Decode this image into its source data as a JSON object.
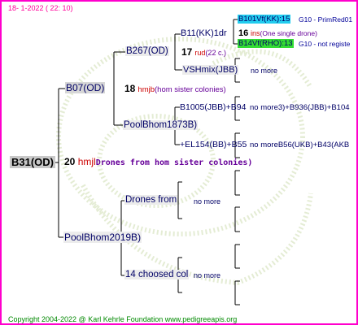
{
  "header": {
    "date": "18-  1-2022 ( 22: 10)"
  },
  "footer": {
    "copyright": "Copyright 2004-2022 @ Karl Kehrle Foundation   www.pedigreeapis.org"
  },
  "root": {
    "label": "B31(OD)",
    "num": "20",
    "code": "hmjl",
    "note": "Drones from hom sister colonies)"
  },
  "gen1": {
    "top": {
      "label": "B07(OD)",
      "num": "18",
      "code": "hmjb",
      "note": "(hom sister colonies)"
    },
    "bottom": {
      "label": "PoolBhom2019B)"
    }
  },
  "gen2": {
    "b267": {
      "label": "B267(OD)",
      "num": "17",
      "code": "rud",
      "note": "(22 c.)"
    },
    "poolbhom": {
      "label": "PoolBhom1873B)"
    },
    "drones": {
      "label": "Drones from",
      "no_more": "no more"
    },
    "chosen": {
      "label": "14 choosed col",
      "no_more": "no more"
    }
  },
  "gen3": {
    "b11": {
      "label": "B11(KK)1dr",
      "num": "16",
      "code": "ins",
      "note": "(One single drone)"
    },
    "vshmix": {
      "label": "VSHmix(JBB)",
      "no_more": "no more"
    },
    "b1005": {
      "label": "B1005(JBB)+B94",
      "extra": "no more3)+B936(JBB)+B104"
    },
    "el154": {
      "label": "+EL154(BB)+B55",
      "extra": "no moreB56(UKB)+B43(AKB"
    }
  },
  "gen4": {
    "b101": {
      "label": "B101Vf(KK):15",
      "g10": "G10 - PrimRed01"
    },
    "b14": {
      "label": "B14Vf(RHO):13",
      "g10": "G10 - not registe"
    }
  },
  "colors": {
    "frame": "#ff00cc",
    "cyan": "#22ccee",
    "green": "#33dd33",
    "accent_red": "#cc0000"
  }
}
